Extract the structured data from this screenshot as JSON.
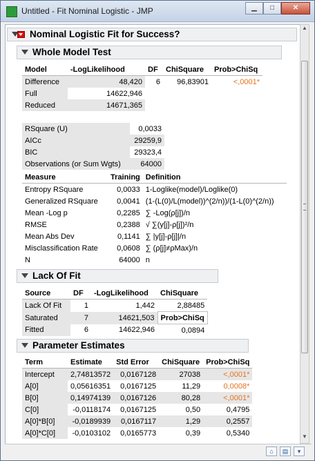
{
  "window": {
    "title": "Untitled - Fit Nominal Logistic - JMP"
  },
  "report": {
    "title": "Nominal Logistic Fit for Success?",
    "whole_model": {
      "title": "Whole Model Test",
      "headers": [
        "Model",
        "-LogLikelihood",
        "DF",
        "ChiSquare",
        "Prob>ChiSq"
      ],
      "rows": [
        {
          "model": "Difference",
          "loglik": "48,420",
          "df": "6",
          "chisq": "96,83901",
          "prob": "<,0001*"
        },
        {
          "model": "Full",
          "loglik": "14622,946",
          "df": "",
          "chisq": "",
          "prob": ""
        },
        {
          "model": "Reduced",
          "loglik": "14671,365",
          "df": "",
          "chisq": "",
          "prob": ""
        }
      ],
      "stats": [
        {
          "label": "RSquare (U)",
          "value": "0,0033"
        },
        {
          "label": "AICc",
          "value": "29259,9"
        },
        {
          "label": "BIC",
          "value": "29323,4"
        },
        {
          "label": "Observations (or Sum Wgts)",
          "value": "64000"
        }
      ],
      "measures_headers": [
        "Measure",
        "Training",
        "Definition"
      ],
      "measures": [
        {
          "measure": "Entropy RSquare",
          "training": "0,0033",
          "definition": "1-Loglike(model)/Loglike(0)"
        },
        {
          "measure": "Generalized RSquare",
          "training": "0,0041",
          "definition": "(1-(L(0)/L(model))^(2/n))/(1-L(0)^(2/n))"
        },
        {
          "measure": "Mean -Log p",
          "training": "0,2285",
          "definition": "∑ -Log(ρ[j])/n"
        },
        {
          "measure": "RMSE",
          "training": "0,2388",
          "definition": "√ ∑(y[j]-ρ[j])²/n"
        },
        {
          "measure": "Mean Abs Dev",
          "training": "0,1141",
          "definition": "∑ |y[j]-ρ[j]|/n"
        },
        {
          "measure": "Misclassification Rate",
          "training": "0,0608",
          "definition": "∑ (ρ[j]≠ρMax)/n"
        },
        {
          "measure": "N",
          "training": "64000",
          "definition": "n"
        }
      ]
    },
    "lack_of_fit": {
      "title": "Lack Of Fit",
      "headers": [
        "Source",
        "DF",
        "-LogLikelihood",
        "ChiSquare"
      ],
      "rows": [
        {
          "source": "Lack Of Fit",
          "df": "1",
          "loglik": "1,442",
          "chisq": "2,88485"
        },
        {
          "source": "Saturated",
          "df": "7",
          "loglik": "14621,503",
          "chisq": "Prob>ChiSq"
        },
        {
          "source": "Fitted",
          "df": "6",
          "loglik": "14622,946",
          "chisq": "0,0894"
        }
      ]
    },
    "parameter_estimates": {
      "title": "Parameter Estimates",
      "headers": [
        "Term",
        "Estimate",
        "Std Error",
        "ChiSquare",
        "Prob>ChiSq"
      ],
      "rows": [
        {
          "term": "Intercept",
          "estimate": "2,74813572",
          "stderr": "0,0167128",
          "chisq": "27038",
          "prob": "<,0001*"
        },
        {
          "term": "A[0]",
          "estimate": "0,05616351",
          "stderr": "0,0167125",
          "chisq": "11,29",
          "prob": "0,0008*"
        },
        {
          "term": "B[0]",
          "estimate": "0,14974139",
          "stderr": "0,0167126",
          "chisq": "80,28",
          "prob": "<,0001*"
        },
        {
          "term": "C[0]",
          "estimate": "-0,0118174",
          "stderr": "0,0167125",
          "chisq": "0,50",
          "prob": "0,4795"
        },
        {
          "term": "A[0]*B[0]",
          "estimate": "-0,0189939",
          "stderr": "0,0167117",
          "chisq": "1,29",
          "prob": "0,2557"
        },
        {
          "term": "A[0]*C[0]",
          "estimate": "-0,0103102",
          "stderr": "0,0165773",
          "chisq": "0,39",
          "prob": "0,5340"
        }
      ]
    }
  },
  "colors": {
    "significant": "#e6721c"
  }
}
